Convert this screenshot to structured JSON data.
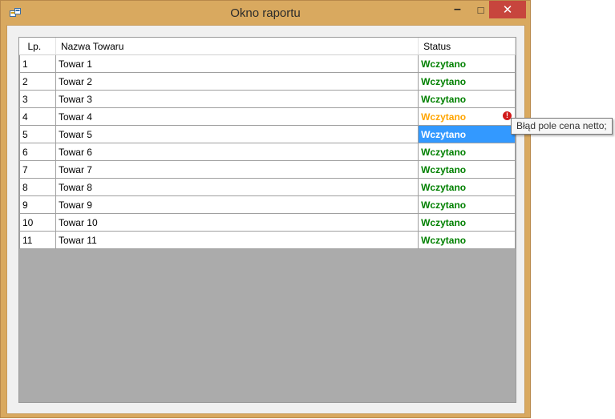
{
  "window": {
    "title": "Okno raportu",
    "minimize_glyph": "–",
    "maximize_glyph": "□",
    "close_glyph": "✕",
    "colors": {
      "frame": "#d9a95f",
      "close": "#c7453d"
    }
  },
  "grid": {
    "columns": [
      "Lp.",
      "Nazwa Towaru",
      "Status"
    ],
    "rows": [
      {
        "lp": "1",
        "name": "Towar 1",
        "status": "Wczytano",
        "state": "ok"
      },
      {
        "lp": "2",
        "name": "Towar 2",
        "status": "Wczytano",
        "state": "ok"
      },
      {
        "lp": "3",
        "name": "Towar 3",
        "status": "Wczytano",
        "state": "ok"
      },
      {
        "lp": "4",
        "name": "Towar 4",
        "status": "Wczytano",
        "state": "warn",
        "error": true
      },
      {
        "lp": "5",
        "name": "Towar 5",
        "status": "Wczytano",
        "state": "selected"
      },
      {
        "lp": "6",
        "name": "Towar 6",
        "status": "Wczytano",
        "state": "ok"
      },
      {
        "lp": "7",
        "name": "Towar 7",
        "status": "Wczytano",
        "state": "ok"
      },
      {
        "lp": "8",
        "name": "Towar 8",
        "status": "Wczytano",
        "state": "ok"
      },
      {
        "lp": "9",
        "name": "Towar 9",
        "status": "Wczytano",
        "state": "ok"
      },
      {
        "lp": "10",
        "name": "Towar 10",
        "status": "Wczytano",
        "state": "ok"
      },
      {
        "lp": "11",
        "name": "Towar 11",
        "status": "Wczytano",
        "state": "ok"
      }
    ],
    "colors": {
      "ok": "#008000",
      "warn": "#ffa500",
      "selected_bg": "#3399ff",
      "empty_area": "#ababab"
    }
  },
  "error_icon": {
    "icon": "error-icon",
    "glyph": "!"
  },
  "tooltip": {
    "text": "Błąd pole cena netto;"
  }
}
